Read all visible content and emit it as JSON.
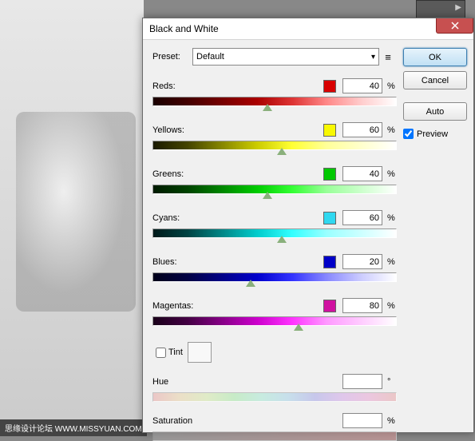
{
  "watermark": "思缘设计论坛  WWW.MISSYUAN.COM",
  "dialog": {
    "title": "Black and White",
    "preset_label": "Preset:",
    "preset_value": "Default",
    "sliders": [
      {
        "label": "Reds:",
        "color": "#d80000",
        "value": "40",
        "pos": 47
      },
      {
        "label": "Yellows:",
        "color": "#f8f800",
        "value": "60",
        "pos": 53
      },
      {
        "label": "Greens:",
        "color": "#00c800",
        "value": "40",
        "pos": 47
      },
      {
        "label": "Cyans:",
        "color": "#30d8f0",
        "value": "60",
        "pos": 53
      },
      {
        "label": "Blues:",
        "color": "#0000c8",
        "value": "20",
        "pos": 40
      },
      {
        "label": "Magentas:",
        "color": "#d010a0",
        "value": "80",
        "pos": 60
      }
    ],
    "tint_label": "Tint",
    "hue_label": "Hue",
    "hue_unit": "°",
    "sat_label": "Saturation",
    "sat_unit": "%"
  },
  "buttons": {
    "ok": "OK",
    "cancel": "Cancel",
    "auto": "Auto",
    "preview": "Preview"
  }
}
